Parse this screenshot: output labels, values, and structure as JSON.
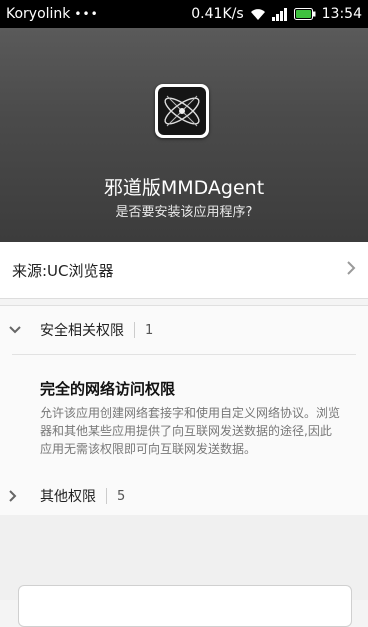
{
  "status_bar": {
    "carrier": "Koryolink",
    "dots": "•••",
    "speed": "0.41K/s",
    "time": "13:54",
    "icons": [
      "wifi-icon",
      "signal-icon",
      "battery-icon"
    ]
  },
  "install_header": {
    "icon_name": "app-logo-icon",
    "app_name": "邪道版MMDAgent",
    "question": "是否要安装该应用程序?"
  },
  "source": {
    "label": "来源:UC浏览器"
  },
  "permissions": {
    "security": {
      "label": "安全相关权限",
      "count": "1"
    },
    "item": {
      "title": "完全的网络访问权限",
      "description": "允许该应用创建网络套接字和使用自定义网络协议。浏览器和其他某些应用提供了向互联网发送数据的途径,因此应用无需该权限即可向互联网发送数据。"
    },
    "other": {
      "label": "其他权限",
      "count": "5"
    }
  },
  "colors": {
    "header_bg": "#4b4b4b",
    "status_bar_bg": "#000000",
    "battery": "#3fc23f"
  }
}
